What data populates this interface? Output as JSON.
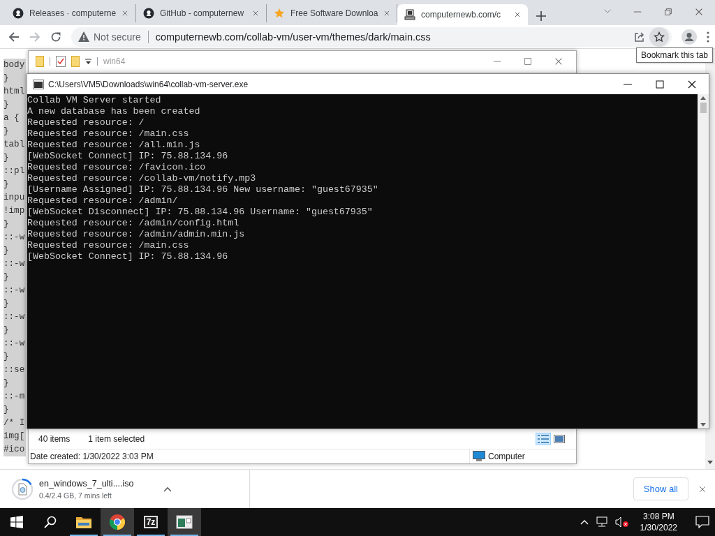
{
  "browser": {
    "tabs": [
      {
        "title": "Releases · computerne",
        "kind": "circle",
        "selected": false
      },
      {
        "title": "GitHub - computernew",
        "kind": "circle",
        "selected": false
      },
      {
        "title": "Free Software Downloa",
        "kind": "star",
        "selected": false
      },
      {
        "title": "computernewb.com/c",
        "kind": "computer",
        "selected": true
      }
    ],
    "security": "Not secure",
    "url": "computernewb.com/collab-vm/user-vm/themes/dark/main.css",
    "tooltip": "Bookmark this tab"
  },
  "page": {
    "lines": [
      "body",
      "}",
      "html",
      "}",
      "a {",
      "}",
      "tabl",
      "}",
      "::pl",
      "}",
      "inpu",
      "!imp",
      "}",
      "::-w",
      "}",
      "::-w",
      "}",
      "::-w",
      "}",
      "::-w",
      "}",
      "::-w",
      "}",
      "::se",
      "}",
      "::-m",
      "}",
      "/* I",
      "img[",
      "#ico"
    ]
  },
  "explorer": {
    "title": "win64",
    "item_count": "40 items",
    "selection": "1 item selected",
    "date_created": "Date created: 1/30/2022 3:03 PM",
    "location": "Computer"
  },
  "console": {
    "title": "C:\\Users\\VM5\\Downloads\\win64\\collab-vm-server.exe",
    "lines": [
      "Collab VM Server started",
      "A new database has been created",
      "Requested resource: /",
      "Requested resource: /main.css",
      "Requested resource: /all.min.js",
      "[WebSocket Connect] IP: 75.88.134.96",
      "Requested resource: /favicon.ico",
      "Requested resource: /collab-vm/notify.mp3",
      "[Username Assigned] IP: 75.88.134.96 New username: \"guest67935\"",
      "Requested resource: /admin/",
      "[WebSocket Disconnect] IP: 75.88.134.96 Username: \"guest67935\"",
      "Requested resource: /admin/config.html",
      "Requested resource: /admin/admin.min.js",
      "Requested resource: /main.css",
      "[WebSocket Connect] IP: 75.88.134.96"
    ]
  },
  "download": {
    "file": "en_windows_7_ulti....iso",
    "progress": "0.4/2.4 GB, 7 mins left",
    "level": 0.17,
    "show_all": "Show all"
  },
  "taskbar": {
    "apps": [
      {
        "kind": "folder",
        "selected": false
      },
      {
        "kind": "chrome",
        "selected": true
      },
      {
        "kind": "archive",
        "label": "7z",
        "selected": false
      },
      {
        "kind": "console",
        "selected": true
      }
    ],
    "time": "3:08 PM",
    "date": "1/30/2022"
  }
}
